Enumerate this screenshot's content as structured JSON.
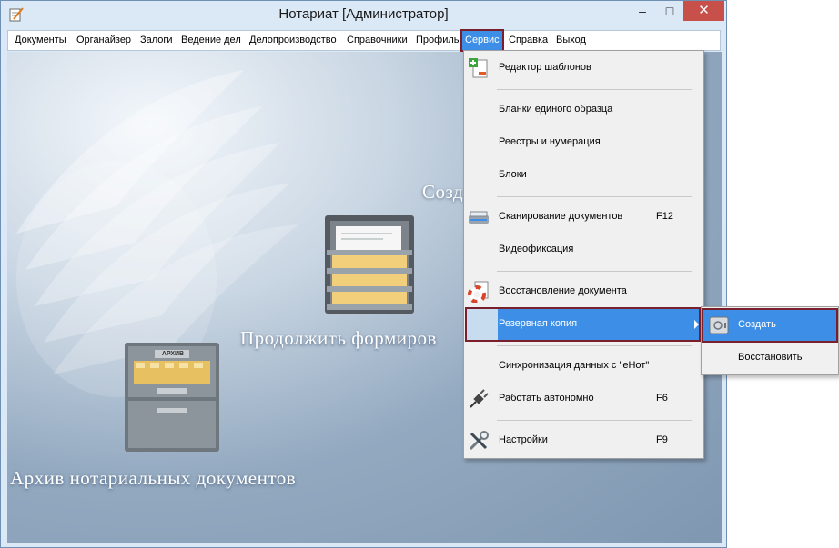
{
  "window": {
    "title": "Нотариат [Администратор]",
    "controls": {
      "minimize": "–",
      "maximize": "□",
      "close": "✕"
    }
  },
  "menubar": {
    "items": [
      "Документы",
      "Органайзер",
      "Залоги",
      "Ведение дел",
      "Делопроизводство",
      "Справочники",
      "Профиль",
      "Сервис",
      "Справка",
      "Выход"
    ],
    "active": "Сервис"
  },
  "desktop": {
    "caption_continue": "Продолжить формиров",
    "caption_create": "Созд",
    "caption_archive": "Архив нотариальных документов",
    "cabinet_label": "АРХИВ"
  },
  "service_menu": {
    "items": [
      {
        "label": "Редактор шаблонов",
        "icon": "template-editor-icon"
      },
      {
        "label": "Бланки единого образца"
      },
      {
        "label": "Реестры и нумерация"
      },
      {
        "label": "Блоки"
      },
      {
        "label": "Сканирование документов",
        "shortcut": "F12",
        "icon": "scanner-icon"
      },
      {
        "label": "Видеофиксация"
      },
      {
        "label": "Восстановление документа",
        "icon": "lifebuoy-icon"
      },
      {
        "label": "Резервная копия",
        "highlighted": true
      },
      {
        "label": "Синхронизация данных с \"еНот\""
      },
      {
        "label": "Работать автономно",
        "shortcut": "F6",
        "icon": "plug-icon"
      },
      {
        "label": "Настройки",
        "shortcut": "F9",
        "icon": "tools-icon"
      }
    ]
  },
  "backup_submenu": {
    "items": [
      {
        "label": "Создать",
        "highlighted": true,
        "icon": "safe-icon"
      },
      {
        "label": "Восстановить"
      }
    ]
  },
  "colors": {
    "highlight": "#3d8ee6",
    "focus_outline": "#7a1f2c",
    "close_button": "#c7504b"
  }
}
